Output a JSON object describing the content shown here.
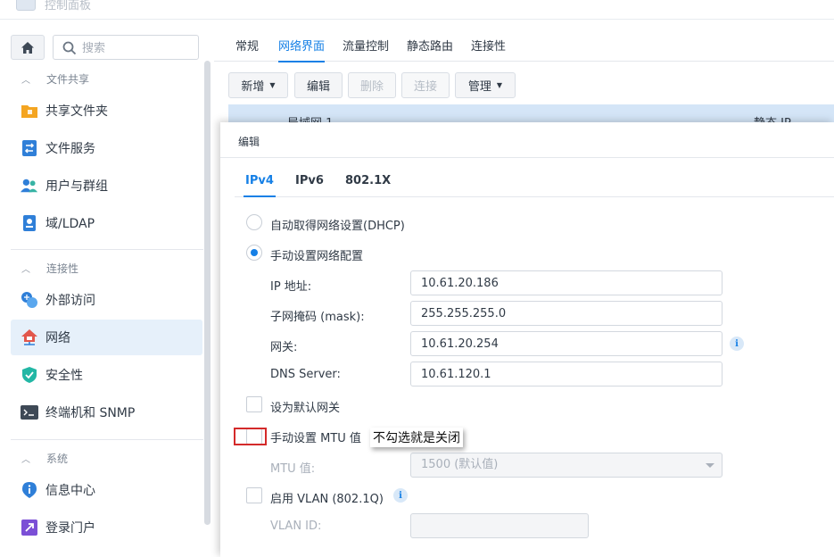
{
  "window": {
    "title": "控制面板"
  },
  "sidebar": {
    "search_placeholder": "搜索",
    "sections": [
      {
        "title": "文件共享",
        "items": [
          {
            "label": "共享文件夹",
            "icon": "shared-folder-icon"
          },
          {
            "label": "文件服务",
            "icon": "file-services-icon"
          },
          {
            "label": "用户与群组",
            "icon": "users-icon"
          },
          {
            "label": "域/LDAP",
            "icon": "domain-ldap-icon"
          }
        ]
      },
      {
        "title": "连接性",
        "items": [
          {
            "label": "外部访问",
            "icon": "external-access-icon"
          },
          {
            "label": "网络",
            "icon": "network-house-icon",
            "active": true
          },
          {
            "label": "安全性",
            "icon": "security-shield-icon"
          },
          {
            "label": "终端机和 SNMP",
            "icon": "terminal-icon"
          }
        ]
      },
      {
        "title": "系统",
        "items": [
          {
            "label": "信息中心",
            "icon": "info-center-icon"
          },
          {
            "label": "登录门户",
            "icon": "login-portal-icon"
          }
        ]
      }
    ]
  },
  "main": {
    "tabs": [
      "常规",
      "网络界面",
      "流量控制",
      "静态路由",
      "连接性"
    ],
    "active_tab": 1,
    "toolbar": {
      "add": "新增",
      "edit": "编辑",
      "delete": "删除",
      "connect": "连接",
      "manage": "管理"
    },
    "table_partial": {
      "name": "局域网 1",
      "type": "静态 IP"
    }
  },
  "dialog": {
    "title": "编辑",
    "tabs": [
      "IPv4",
      "IPv6",
      "802.1X"
    ],
    "active_tab": 0,
    "dhcp_label": "自动取得网络设置(DHCP)",
    "manual_label": "手动设置网络配置",
    "ip_label": "IP 地址:",
    "ip_value": "10.61.20.186",
    "mask_label": "子网掩码 (mask):",
    "mask_value": "255.255.255.0",
    "gateway_label": "网关:",
    "gateway_value": "10.61.20.254",
    "dns_label": "DNS Server:",
    "dns_value": "10.61.120.1",
    "default_gateway_label": "设为默认网关",
    "mtu_manual_label": "手动设置 MTU 值",
    "mtu_label": "MTU 值:",
    "mtu_value": "1500 (默认值)",
    "vlan_label": "启用 VLAN (802.1Q)",
    "vlan_id_label": "VLAN ID:",
    "vlan_id_value": ""
  },
  "annotation": {
    "text": "不勾选就是关闭",
    "border_color": "#d42a2a"
  },
  "colors": {
    "accent": "#1680e6",
    "active_bg": "#e6f0fa"
  }
}
